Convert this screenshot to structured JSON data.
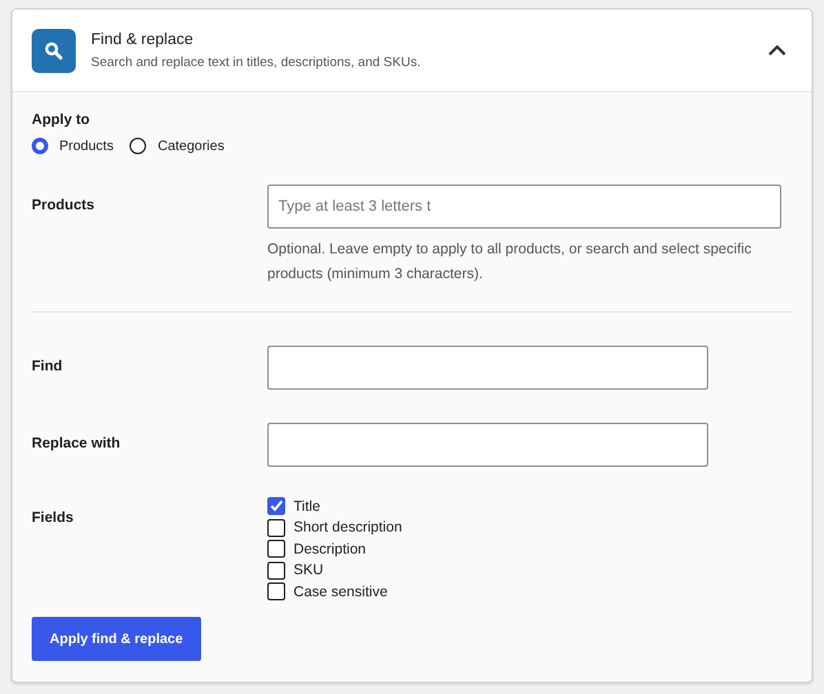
{
  "panel": {
    "title": "Find & replace",
    "subtitle": "Search and replace text in titles, descriptions, and SKUs.",
    "expanded": true
  },
  "apply_to": {
    "label": "Apply to",
    "options": [
      {
        "label": "Products",
        "selected": true
      },
      {
        "label": "Categories",
        "selected": false
      }
    ]
  },
  "products": {
    "label": "Products",
    "placeholder": "Type at least 3 letters t",
    "help": "Optional. Leave empty to apply to all products, or search and select specific products (minimum 3 characters)."
  },
  "find": {
    "label": "Find"
  },
  "replace": {
    "label": "Replace with"
  },
  "fields": {
    "label": "Fields",
    "options": [
      {
        "label": "Title",
        "checked": true
      },
      {
        "label": "Short description",
        "checked": false
      },
      {
        "label": "Description",
        "checked": false
      },
      {
        "label": "SKU",
        "checked": false
      },
      {
        "label": "Case sensitive",
        "checked": false
      }
    ]
  },
  "button": "Apply find & replace"
}
